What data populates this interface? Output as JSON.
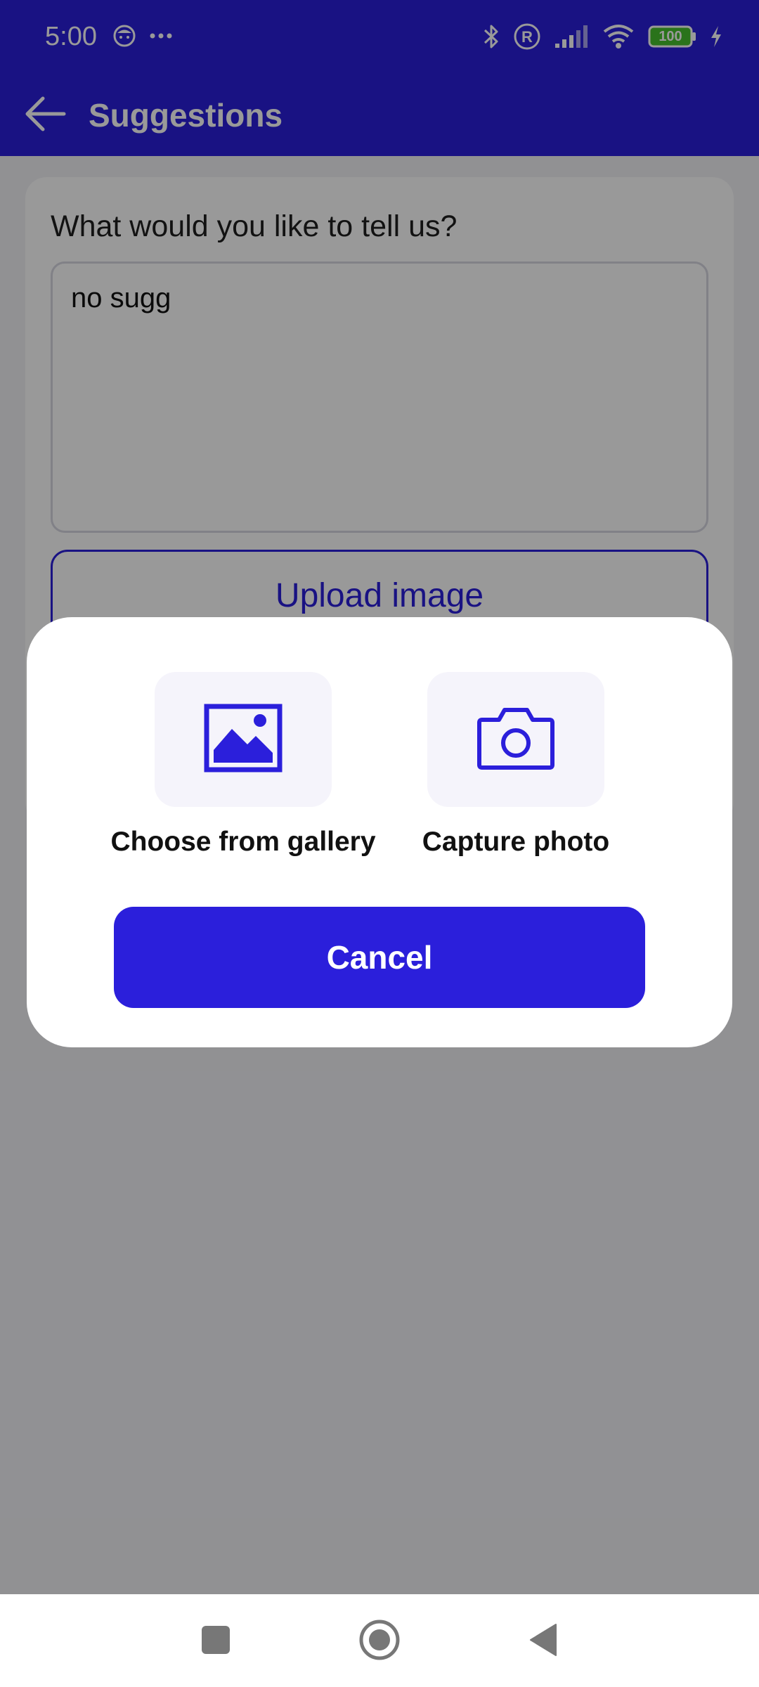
{
  "status_bar": {
    "time": "5:00",
    "left_icons": [
      "notification-face-icon",
      "more-dots-icon"
    ],
    "right_icons": [
      "bluetooth-icon",
      "registered-icon",
      "signal-icon",
      "wifi-icon",
      "battery-icon",
      "charging-icon"
    ],
    "battery_level": "100"
  },
  "app_bar": {
    "title": "Suggestions",
    "back_icon": "arrow-left-icon"
  },
  "form": {
    "question": "What would you like to tell us?",
    "textarea_value": "no sugg",
    "upload_label": "Upload image"
  },
  "dialog": {
    "options": [
      {
        "label": "Choose from gallery",
        "icon": "gallery-icon"
      },
      {
        "label": "Capture photo",
        "icon": "camera-icon"
      }
    ],
    "cancel_label": "Cancel"
  },
  "nav_bar": {
    "icons": [
      "recents-square-icon",
      "home-circle-icon",
      "back-triangle-icon"
    ]
  },
  "colors": {
    "accent": "#2b1fdb",
    "scrim": "rgba(0,0,0,0.40)",
    "tile_background": "#f5f4fb"
  }
}
